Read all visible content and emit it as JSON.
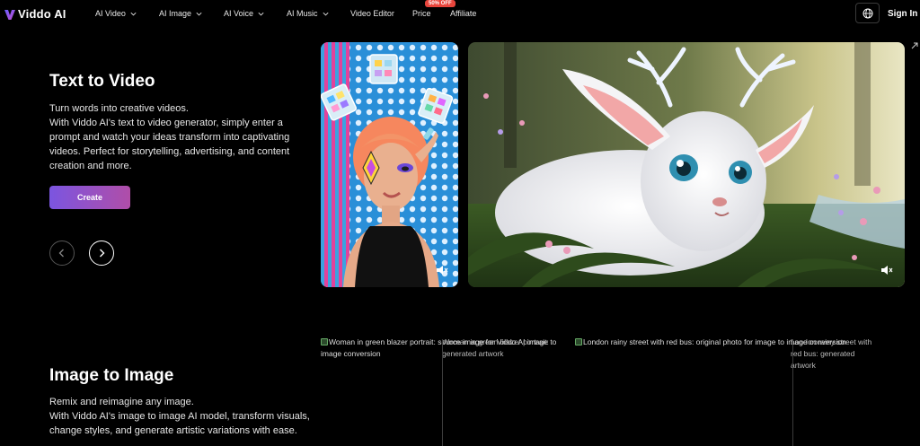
{
  "brand": {
    "name": "Viddo AI"
  },
  "nav": {
    "items": [
      {
        "label": "AI Video",
        "has_dropdown": true
      },
      {
        "label": "AI Image",
        "has_dropdown": true
      },
      {
        "label": "AI Voice",
        "has_dropdown": true
      },
      {
        "label": "AI Music",
        "has_dropdown": true
      },
      {
        "label": "Video Editor",
        "has_dropdown": false
      },
      {
        "label": "Price",
        "has_dropdown": false
      },
      {
        "label": "Affiliate",
        "has_dropdown": false
      }
    ],
    "price_badge": "50% OFF",
    "language_icon": "globe-icon",
    "signin_label": "Sign In"
  },
  "hero": {
    "title": "Text to Video",
    "description": "Turn words into creative videos.\nWith Viddo AI's text to video generator, simply enter a prompt and watch your ideas transform into captivating videos. Perfect for storytelling, advertising, and content creation and more.",
    "cta_label": "Create",
    "accent_gradient": [
      "#7b55e0",
      "#b04ea8"
    ]
  },
  "section2": {
    "title": "Image to Image",
    "description": "Remix and reimagine any image.\nWith Viddo AI's image to image AI model, transform visuals, change styles, and generate artistic variations with ease.",
    "image_alts": [
      "Woman in green blazer portrait: source image for Viddo AI image to image conversion",
      "Woman in green blazer portrait: generated artwork",
      "London rainy street with red bus: original photo for image to image conversion",
      "London rainy street with red bus: generated artwork"
    ]
  }
}
